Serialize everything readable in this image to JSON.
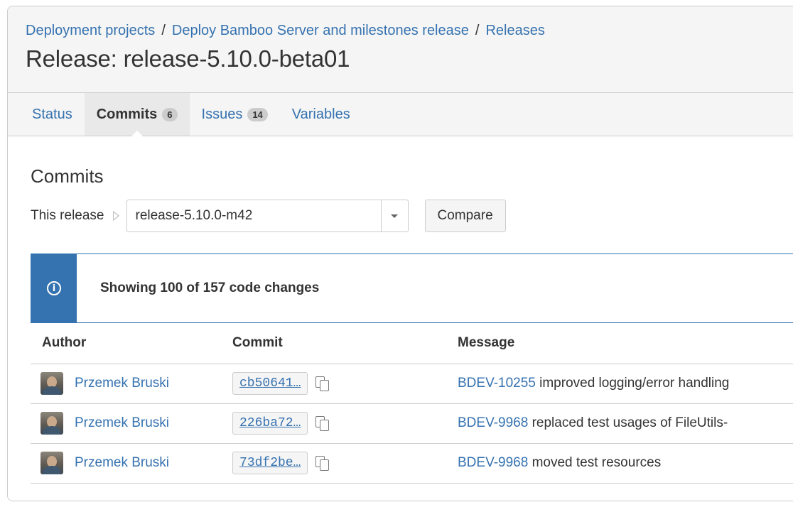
{
  "breadcrumbs": {
    "items": [
      "Deployment projects",
      "Deploy Bamboo Server and milestones release",
      "Releases"
    ],
    "separator": "/"
  },
  "page": {
    "title": "Release: release-5.10.0-beta01"
  },
  "tabs": [
    {
      "label": "Status",
      "badge": null,
      "active": false
    },
    {
      "label": "Commits",
      "badge": "6",
      "active": true
    },
    {
      "label": "Issues",
      "badge": "14",
      "active": false
    },
    {
      "label": "Variables",
      "badge": null,
      "active": false
    }
  ],
  "commits": {
    "title": "Commits",
    "compare": {
      "label": "This release",
      "selected": "release-5.10.0-m42",
      "button": "Compare"
    },
    "notice": "Showing 100 of 157 code changes",
    "columns": {
      "author": "Author",
      "commit": "Commit",
      "message": "Message"
    },
    "rows": [
      {
        "author": "Przemek Bruski",
        "hash": "cb50641…",
        "issue": "BDEV-10255",
        "message": " improved logging/error handling"
      },
      {
        "author": "Przemek Bruski",
        "hash": "226ba72…",
        "issue": "BDEV-9968",
        "message": " replaced test usages of FileUtils-"
      },
      {
        "author": "Przemek Bruski",
        "hash": "73df2be…",
        "issue": "BDEV-9968",
        "message": " moved test resources"
      }
    ]
  },
  "colors": {
    "link": "#3572b0",
    "border": "#cccccc",
    "header_bg": "#f5f5f5"
  }
}
